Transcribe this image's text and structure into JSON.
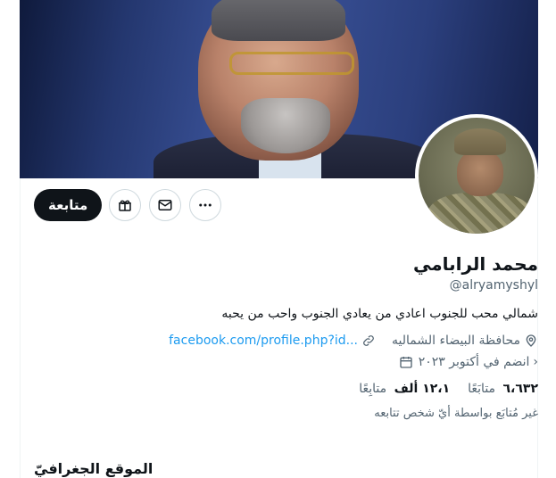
{
  "actions": {
    "follow_label": "متابعة",
    "more_icon": "more-horizontal-icon",
    "message_icon": "mail-icon",
    "gift_icon": "gift-icon"
  },
  "profile": {
    "name": "محمد الرابامي",
    "handle": "@alryamyshyl",
    "bio": "شمالي محب للجنوب اعادي من يعادي الجنوب واحب من يحبه",
    "website": "facebook.com/profile.php?id...",
    "location": "محافظة البيضاء الشماليه",
    "joined": "انضم في أكتوبر ٢٠٢٣",
    "following_count": "٦،٦٣٢",
    "following_label": "متابَعًا",
    "followers_count": "١٢،١ ألف",
    "followers_label": "متابِعًا",
    "not_followed_note": "غير مُتابَع بواسطة أيّ شخص تتابعه"
  },
  "section": {
    "title": "الموقع الجغرافيّ"
  },
  "colors": {
    "link": "#1d9bf0",
    "primary_button": "#0f1419",
    "secondary_text": "#536471"
  }
}
